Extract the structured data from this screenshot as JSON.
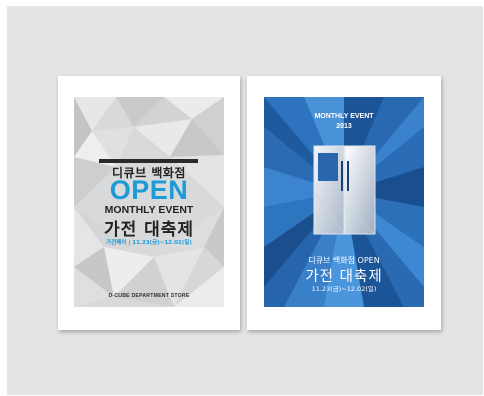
{
  "left_poster": {
    "store_title": "디큐브 백화점",
    "open": "OPEN",
    "monthly_event": "MONTHLY EVENT",
    "event_name": "가전 대축제",
    "date_line": "가전페어 | 11.23(금)~12.02(일)",
    "store_name": "D-CUBE DEPARTMENT STORE"
  },
  "right_poster": {
    "monthly_event": "MONTHLY EVENT",
    "year": "2013",
    "store_title": "디큐브 백화점 OPEN",
    "event_name": "가전 대축제",
    "date_line": "11.23(금)~12.02(일)"
  },
  "colors": {
    "background": "#e4e4e4",
    "accent_blue": "#1d9ad8",
    "poster_blue": "#1f5fa6",
    "poster_gray": "#d9dadc"
  }
}
